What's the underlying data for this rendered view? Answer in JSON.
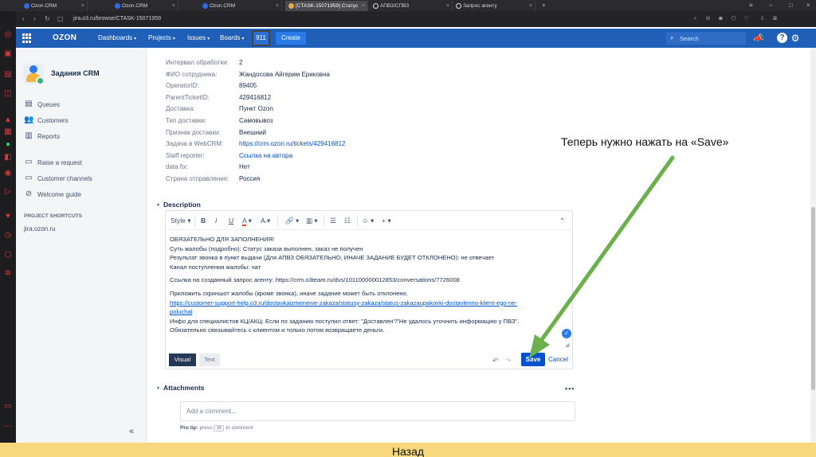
{
  "browser": {
    "tabs": [
      {
        "title": "Ozon.CRM",
        "active": false
      },
      {
        "title": "Ozon.CRM",
        "active": false
      },
      {
        "title": "Ozon.CRM",
        "active": false
      },
      {
        "title": "[CTASK-15071959] Статус",
        "active": true
      },
      {
        "title": "АПВЗ/СПВЗ",
        "active": false
      },
      {
        "title": "Запрос агенту",
        "active": false
      }
    ],
    "url": "jira.o3.ru/browse/CTASK-15071959"
  },
  "topnav": {
    "logo": "OZON",
    "items": [
      {
        "label": "Dashboards"
      },
      {
        "label": "Projects"
      },
      {
        "label": "Issues"
      },
      {
        "label": "Boards"
      }
    ],
    "badge": "911",
    "create_label": "Create",
    "search_placeholder": "Search"
  },
  "sidebar": {
    "project_name": "Задания CRM",
    "items": [
      {
        "label": "Queues",
        "icon": "queues-icon"
      },
      {
        "label": "Customers",
        "icon": "customers-icon"
      },
      {
        "label": "Reports",
        "icon": "reports-icon"
      },
      {
        "label": "Raise a request",
        "icon": "raise-request-icon"
      },
      {
        "label": "Customer channels",
        "icon": "customer-channels-icon"
      },
      {
        "label": "Welcome guide",
        "icon": "welcome-guide-icon"
      }
    ],
    "section_title": "PROJECT SHORTCUTS",
    "shortcut": "jira.ozon.ru",
    "collapse_glyph": "«"
  },
  "fields": [
    {
      "label": "Интервал обработки:",
      "value": "2",
      "link": false
    },
    {
      "label": "ФИО сотрудника:",
      "value": "Жандосова Айгерим Ериковна",
      "link": false
    },
    {
      "label": "OperatorID:",
      "value": "89405",
      "link": false
    },
    {
      "label": "ParentTicketID:",
      "value": "429416812",
      "link": false
    },
    {
      "label": "Доставка:",
      "value": "Пункт Ozon",
      "link": false
    },
    {
      "label": "Тип доставки:",
      "value": "Самовывоз",
      "link": false
    },
    {
      "label": "Признак доставки:",
      "value": "Внешний",
      "link": false
    },
    {
      "label": "Задача в WebCRM:",
      "value": "https://crm.ozon.ru/tickets/429416812",
      "link": true
    },
    {
      "label": "Staff reporter:",
      "value": "Ссылка на автора",
      "link": true
    },
    {
      "label": "data fix:",
      "value": "Нет",
      "link": false
    },
    {
      "label": "Страна отправления:",
      "value": "Россия",
      "link": false
    }
  ],
  "description": {
    "title": "Description",
    "toolbar": {
      "style": "Style",
      "bold": "B",
      "italic": "I",
      "underline": "U",
      "color": "A"
    },
    "paragraphs": [
      [
        "ОБЯЗАТЕЛЬНО ДЛЯ ЗАПОЛНЕНИЯ!",
        "Суть жалобы (подробно): Статус заказа выполнен, заказ не получен",
        "Результат звонка в пункт выдачи (Для АПВЗ ОБЯЗАТЕЛЬНО, ИНАЧЕ ЗАДАНИЕ БУДЕТ ОТКЛОНЕНО): не отвечает",
        "Канал поступления жалобы: чат"
      ],
      [
        "Ссылка на созданный запрос агенту: https://crm.o3team.ru/dvs/101100000012853/conversations/7726008"
      ]
    ],
    "para3_line1": "Приложить скриншот жалобы (кроме звонка), иначе задание может быть отклонено.",
    "para3_link1": "https://customer-support-help.o3.ru/dostavkaizmenenie-zakaza/statusy-zakaza/status-zakazaupakovki-dostavlenno-klient-ego-ne-",
    "para3_link2": "poluchal",
    "para3_line2": "Инфо для специалистов КЦ/АКЦ: Если по заданию поступил ответ: \"Доставлен\"/\"Не удалось уточнить информацию у ПВЗ\".",
    "para3_line3": "Обязательно связывайтесь с клиентом и только потом возвращаете деньги.",
    "mode_visual": "Visual",
    "mode_text": "Text",
    "save_label": "Save",
    "cancel_label": "Cancel"
  },
  "attachments": {
    "title": "Attachments",
    "more": "•••",
    "comment_placeholder": "Add a comment...",
    "pro_tip_label": "Pro tip:",
    "pro_tip_press": "press",
    "pro_tip_key": "m",
    "pro_tip_rest": "to comment"
  },
  "annotation": {
    "text": "Теперь нужно нажать на «Save»",
    "arrow_color": "#6ab04c"
  },
  "footer": {
    "back_label": "Назад"
  },
  "colors": {
    "nav": "#1f5fb8",
    "accent": "#0052cc",
    "footer": "#f7d87c"
  }
}
